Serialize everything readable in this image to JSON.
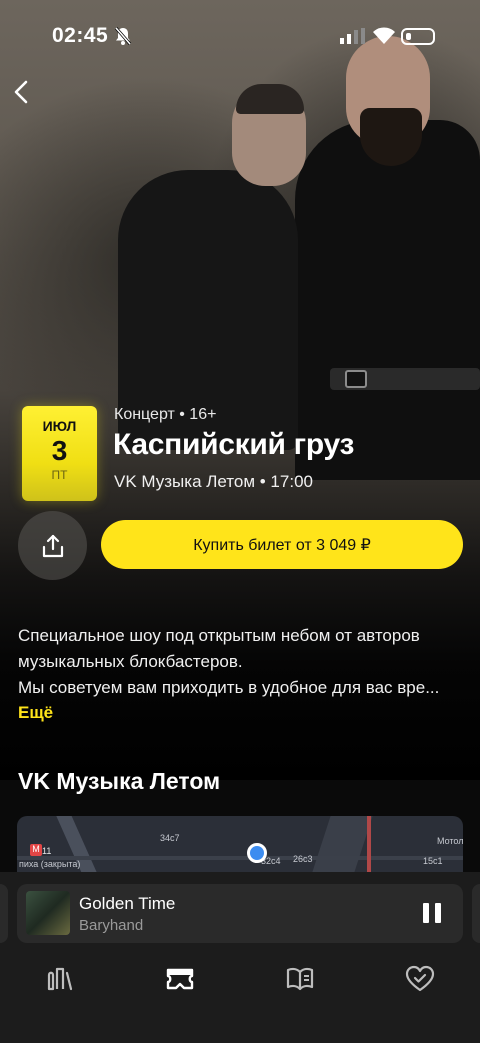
{
  "status_bar": {
    "time": "02:45"
  },
  "event": {
    "date": {
      "month": "ИЮЛ",
      "day": "3",
      "weekday": "ПТ"
    },
    "meta": "Концерт • 16+",
    "title": "Каспийский груз",
    "subtitle": "VK Музыка Летом • 17:00",
    "buy_label": "Купить билет от 3 049 ₽",
    "description_line1": "Специальное шоу под открытым небом от авторов",
    "description_line2": "музыкальных блокбастеров.",
    "description_line3": "Мы советуем вам приходить в удобное для вас вре...",
    "more_label": "Ещё"
  },
  "venue": {
    "title": "VK Музыка Летом",
    "map_labels": {
      "metro": "М",
      "line": "11",
      "station": "пиха (закрыта)",
      "b1": "34с7",
      "b2": "32с4",
      "b3": "26с3",
      "b4": "15с1",
      "b5": "Мотол"
    }
  },
  "player": {
    "track": "Golden Time",
    "artist": "Baryhand",
    "state": "playing"
  },
  "nav": {
    "items": [
      "music-library-icon",
      "afisha-ticket-icon",
      "books-icon",
      "favorites-heart-icon"
    ],
    "active": 1
  },
  "colors": {
    "accent": "#ffe41a",
    "background": "#000000",
    "map_pin": "#3c8cf0"
  }
}
